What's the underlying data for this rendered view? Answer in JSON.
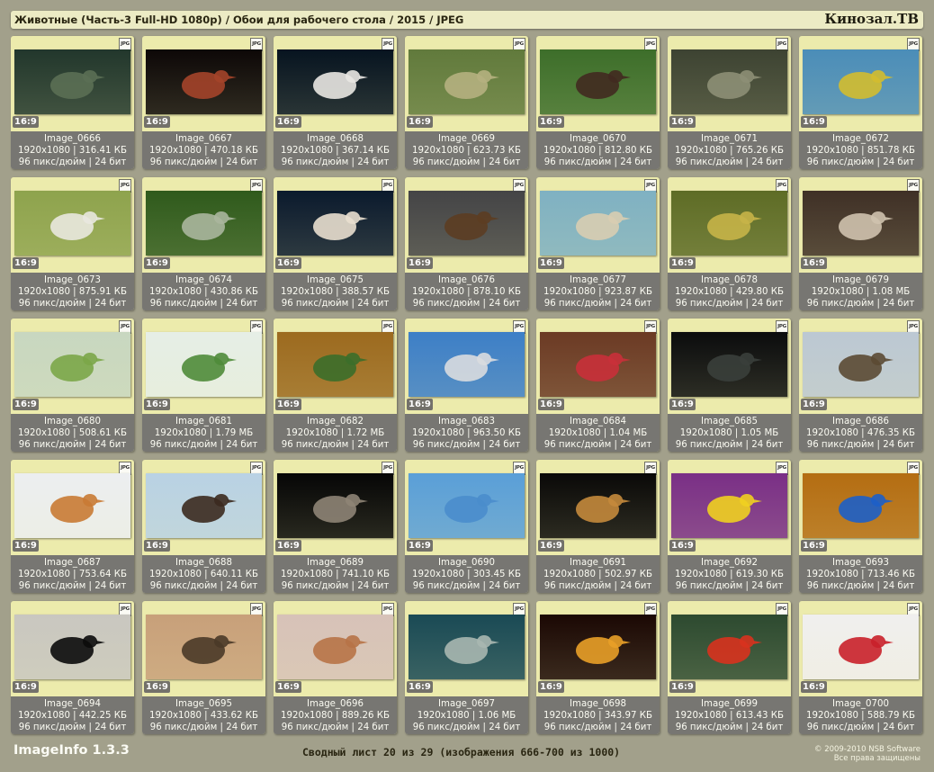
{
  "header": {
    "title": "Животные (Часть-3 Full-HD 1080p) / Обои для рабочего стола / 2015 / JPEG",
    "brand": "Кинозал.ТВ"
  },
  "card_common": {
    "format_icon": "JPG",
    "ratio": "16:9",
    "dpi_line": "96 пикс/дюйм | 24 бит"
  },
  "images": [
    {
      "name": "Image_0666",
      "res": "1920x1080 | 316.41 КБ",
      "icon": "gannet-flying",
      "colors": [
        "#22372c",
        "#5b6f54"
      ]
    },
    {
      "name": "Image_0667",
      "res": "1920x1080 | 470.18 КБ",
      "icon": "heron-on-branch",
      "colors": [
        "#0d0807",
        "#a4442a"
      ]
    },
    {
      "name": "Image_0668",
      "res": "1920x1080 | 367.14 КБ",
      "icon": "gannet",
      "colors": [
        "#071420",
        "#e9e7e2"
      ]
    },
    {
      "name": "Image_0669",
      "res": "1920x1080 | 623.73 КБ",
      "icon": "eagle-landing",
      "colors": [
        "#617a3c",
        "#b5b080"
      ]
    },
    {
      "name": "Image_0670",
      "res": "1920x1080 | 812.80 КБ",
      "icon": "turkey",
      "colors": [
        "#3d6e2a",
        "#412a20"
      ]
    },
    {
      "name": "Image_0671",
      "res": "1920x1080 | 765.26 КБ",
      "icon": "bird-on-rock",
      "colors": [
        "#3d4332",
        "#8d8f76"
      ]
    },
    {
      "name": "Image_0672",
      "res": "1920x1080 | 851.78 КБ",
      "icon": "yellow-bird",
      "colors": [
        "#4b8db8",
        "#d3bc2f"
      ]
    },
    {
      "name": "Image_0673",
      "res": "1920x1080 | 875.91 КБ",
      "icon": "spoonbill",
      "colors": [
        "#8ea34d",
        "#e9e8df"
      ]
    },
    {
      "name": "Image_0674",
      "res": "1920x1080 | 430.86 КБ",
      "icon": "jay-flying",
      "colors": [
        "#2f5a1c",
        "#aab69d"
      ]
    },
    {
      "name": "Image_0675",
      "res": "1920x1080 | 388.57 КБ",
      "icon": "gannet-pair",
      "colors": [
        "#0b1a2d",
        "#e9dfcf"
      ]
    },
    {
      "name": "Image_0676",
      "res": "1920x1080 | 878.10 КБ",
      "icon": "eagle-head",
      "colors": [
        "#444446",
        "#5c3d22"
      ]
    },
    {
      "name": "Image_0677",
      "res": "1920x1080 | 923.87 КБ",
      "icon": "heron-beach",
      "colors": [
        "#7fb1c2",
        "#d8cdb1"
      ]
    },
    {
      "name": "Image_0678",
      "res": "1920x1080 | 429.80 КБ",
      "icon": "bird-on-branch",
      "colors": [
        "#5e6c26",
        "#c7b448"
      ]
    },
    {
      "name": "Image_0679",
      "res": "1920x1080 | 1.08 МБ",
      "icon": "owl-face",
      "colors": [
        "#3f3026",
        "#cfc2ae"
      ]
    },
    {
      "name": "Image_0680",
      "res": "1920x1080 | 508.61 КБ",
      "icon": "puffin",
      "colors": [
        "#c8d7c0",
        "#7ba648"
      ]
    },
    {
      "name": "Image_0681",
      "res": "1920x1080 | 1.79 МБ",
      "icon": "white-peacock",
      "colors": [
        "#e6eee6",
        "#4f8b3a"
      ]
    },
    {
      "name": "Image_0682",
      "res": "1920x1080 | 1.72 МБ",
      "icon": "peacock",
      "colors": [
        "#9c6a1f",
        "#3b6e2a"
      ]
    },
    {
      "name": "Image_0683",
      "res": "1920x1080 | 963.50 КБ",
      "icon": "crows",
      "colors": [
        "#3d7fc7",
        "#d9dcdf"
      ]
    },
    {
      "name": "Image_0684",
      "res": "1920x1080 | 1.04 МБ",
      "icon": "chickadee-berries",
      "colors": [
        "#6b3a24",
        "#c9303a"
      ]
    },
    {
      "name": "Image_0685",
      "res": "1920x1080 | 1.05 МБ",
      "icon": "cormorant",
      "colors": [
        "#0b0c0d",
        "#3a3f3b"
      ]
    },
    {
      "name": "Image_0686",
      "res": "1920x1080 | 476.35 КБ",
      "icon": "falcon",
      "colors": [
        "#bcc8d3",
        "#5b4a33"
      ]
    },
    {
      "name": "Image_0687",
      "res": "1920x1080 | 753.64 КБ",
      "icon": "robin",
      "colors": [
        "#eceef0",
        "#c97a34"
      ]
    },
    {
      "name": "Image_0688",
      "res": "1920x1080 | 640.11 КБ",
      "icon": "snowy-owl",
      "colors": [
        "#b9d2e4",
        "#3b2a1f"
      ]
    },
    {
      "name": "Image_0689",
      "res": "1920x1080 | 741.10 КБ",
      "icon": "scops-owl",
      "colors": [
        "#060606",
        "#8e8476"
      ]
    },
    {
      "name": "Image_0690",
      "res": "1920x1080 | 303.45 КБ",
      "icon": "bird-sky",
      "colors": [
        "#5a9fd8",
        "#4a8dcc"
      ]
    },
    {
      "name": "Image_0691",
      "res": "1920x1080 | 502.97 КБ",
      "icon": "hoopoe-flying",
      "colors": [
        "#0a0908",
        "#c48a3c"
      ]
    },
    {
      "name": "Image_0692",
      "res": "1920x1080 | 619.30 КБ",
      "icon": "goldfinch",
      "colors": [
        "#7a2f86",
        "#f0d020"
      ]
    },
    {
      "name": "Image_0693",
      "res": "1920x1080 | 713.46 КБ",
      "icon": "bunting",
      "colors": [
        "#b46d12",
        "#1d5fc8"
      ]
    },
    {
      "name": "Image_0694",
      "res": "1920x1080 | 442.25 КБ",
      "icon": "crow-head",
      "colors": [
        "#c9c7c0",
        "#0b0b0b"
      ]
    },
    {
      "name": "Image_0695",
      "res": "1920x1080 | 433.62 КБ",
      "icon": "bird-branch-dusk",
      "colors": [
        "#c8a07a",
        "#4a3a28"
      ]
    },
    {
      "name": "Image_0696",
      "res": "1920x1080 | 889.26 КБ",
      "icon": "hoopoe",
      "colors": [
        "#d7c2b8",
        "#b77347"
      ]
    },
    {
      "name": "Image_0697",
      "res": "1920x1080 | 1.06 МБ",
      "icon": "woodpecker-flight",
      "colors": [
        "#1a4a55",
        "#a8b7b0"
      ]
    },
    {
      "name": "Image_0698",
      "res": "1920x1080 | 343.97 КБ",
      "icon": "sunset-bird",
      "colors": [
        "#1b0804",
        "#e9a028"
      ]
    },
    {
      "name": "Image_0699",
      "res": "1920x1080 | 613.43 КБ",
      "icon": "scarlet-ibis",
      "colors": [
        "#2d4a30",
        "#d8321e"
      ]
    },
    {
      "name": "Image_0700",
      "res": "1920x1080 | 588.79 КБ",
      "icon": "hummingbird-feeder",
      "colors": [
        "#f0efee",
        "#c9202a"
      ]
    }
  ],
  "footer": {
    "app_name": "ImageInfo 1.3.3",
    "summary": "Сводный лист 20 из 29 (изображения 666-700 из 1000)",
    "copyright_line1": "© 2009-2010 NSB Software",
    "copyright_line2": "Все права защищены"
  }
}
